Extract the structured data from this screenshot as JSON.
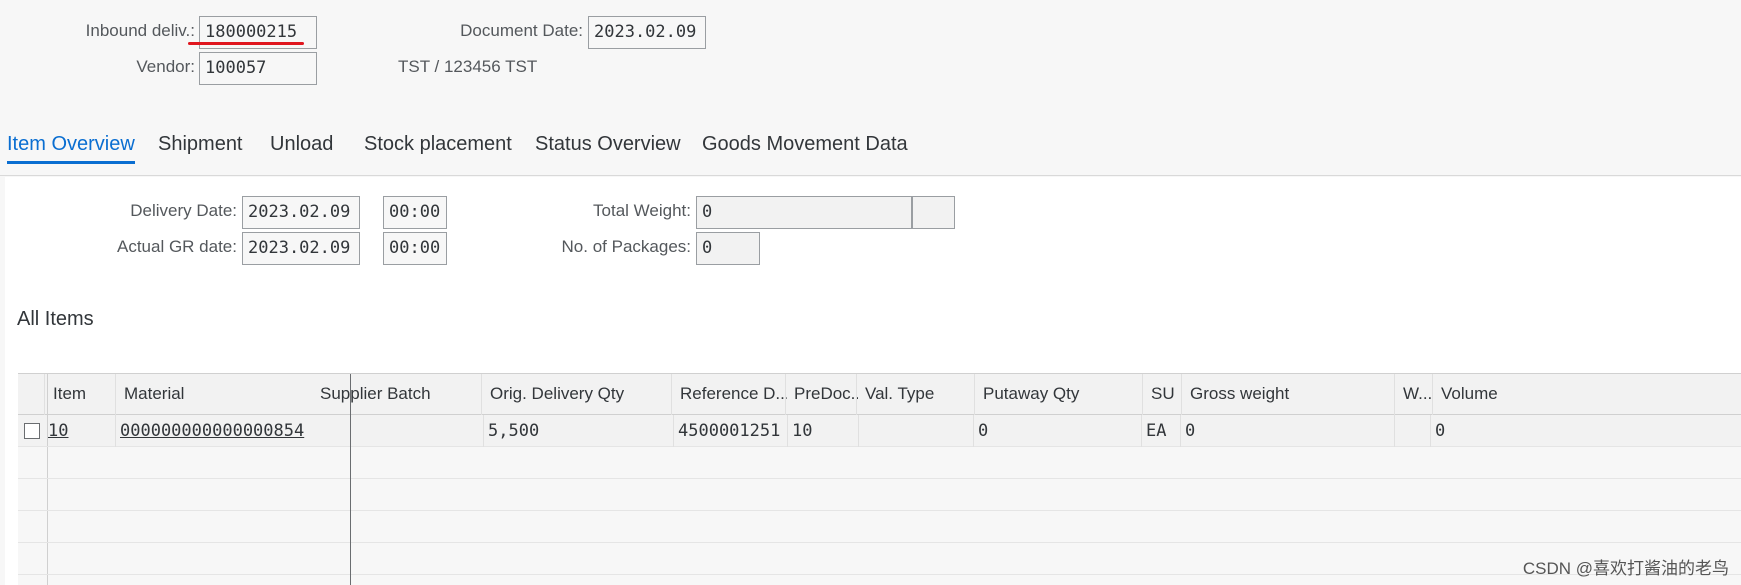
{
  "header": {
    "inbound_label": "Inbound deliv.:",
    "inbound_value": "180000215",
    "docdate_label": "Document Date:",
    "docdate_value": "2023.02.09",
    "vendor_label": "Vendor:",
    "vendor_value": "100057",
    "vendor_name": "TST / 123456 TST",
    "annotation_color": "#e0161e"
  },
  "tabs": [
    {
      "label": "Item Overview",
      "active": true
    },
    {
      "label": "Shipment"
    },
    {
      "label": "Unload"
    },
    {
      "label": "Stock placement"
    },
    {
      "label": "Status Overview"
    },
    {
      "label": "Goods Movement Data"
    }
  ],
  "details": {
    "delivery_date_label": "Delivery Date:",
    "delivery_date_value": "2023.02.09",
    "delivery_time_value": "00:00",
    "actual_gr_label": "Actual GR date:",
    "actual_gr_value": "2023.02.09",
    "actual_gr_time": "00:00",
    "total_weight_label": "Total Weight:",
    "total_weight_value": "0",
    "weight_unit_value": "",
    "packages_label": "No. of Packages:",
    "packages_value": "0"
  },
  "items": {
    "title": "All Items",
    "columns": [
      "Item",
      "Material",
      "Supplier Batch",
      "Orig. Delivery Qty",
      "Reference D...",
      "PreDoc...",
      "Val. Type",
      "Putaway Qty",
      "SU",
      "Gross weight",
      "W...",
      "Volume"
    ],
    "rows": [
      [
        "10",
        "000000000000000854",
        "",
        "5,500",
        "4500001251",
        "10",
        "",
        "0",
        "EA",
        "0",
        "",
        "0"
      ]
    ]
  },
  "watermark": "CSDN @喜欢打酱油的老鸟",
  "colors": {
    "accent": "#0a6ed1"
  }
}
